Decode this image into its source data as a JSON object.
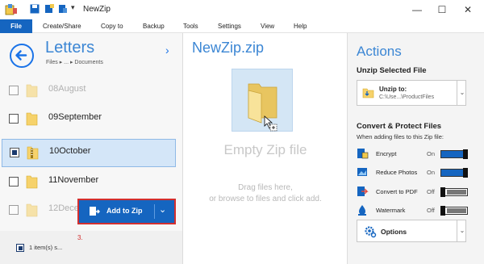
{
  "window": {
    "title": "NewZip"
  },
  "menu": {
    "file": "File",
    "items": [
      "Create/Share",
      "Copy to",
      "Backup",
      "Tools",
      "Settings",
      "View",
      "Help"
    ]
  },
  "left": {
    "title": "Letters",
    "breadcrumb": "Files  ▸  ...  ▸  Documents",
    "rows": [
      {
        "label": "08August",
        "checked": false,
        "selected": false
      },
      {
        "label": "09September",
        "checked": false,
        "selected": false
      },
      {
        "label": "10October",
        "checked": true,
        "selected": true
      },
      {
        "label": "11November",
        "checked": false,
        "selected": false
      },
      {
        "label": "12December",
        "checked": false,
        "selected": false
      }
    ],
    "status": "1 item(s) s...",
    "step": "3.",
    "add_button": "Add to Zip"
  },
  "center": {
    "title": "NewZip.zip",
    "empty": "Empty Zip file",
    "hint_line1": "Drag files here,",
    "hint_line2": "or browse to files and click add."
  },
  "right": {
    "title": "Actions",
    "unzip_section": "Unzip Selected File",
    "unzip_label": "Unzip to:",
    "unzip_path": "C:\\Use...\\ProductFiles",
    "convert_section": "Convert & Protect Files",
    "convert_sub": "When adding files to this Zip file:",
    "options": [
      {
        "label": "Encrypt",
        "state": "On",
        "icon": "shield-lock-icon"
      },
      {
        "label": "Reduce Photos",
        "state": "On",
        "icon": "photo-icon"
      },
      {
        "label": "Convert to PDF",
        "state": "Off",
        "icon": "pdf-icon"
      },
      {
        "label": "Watermark",
        "state": "Off",
        "icon": "watermark-icon"
      }
    ],
    "options_button": "Options"
  },
  "colors": {
    "accent": "#1565c0",
    "title_blue": "#3b86d4",
    "highlight": "#d32f2f"
  }
}
